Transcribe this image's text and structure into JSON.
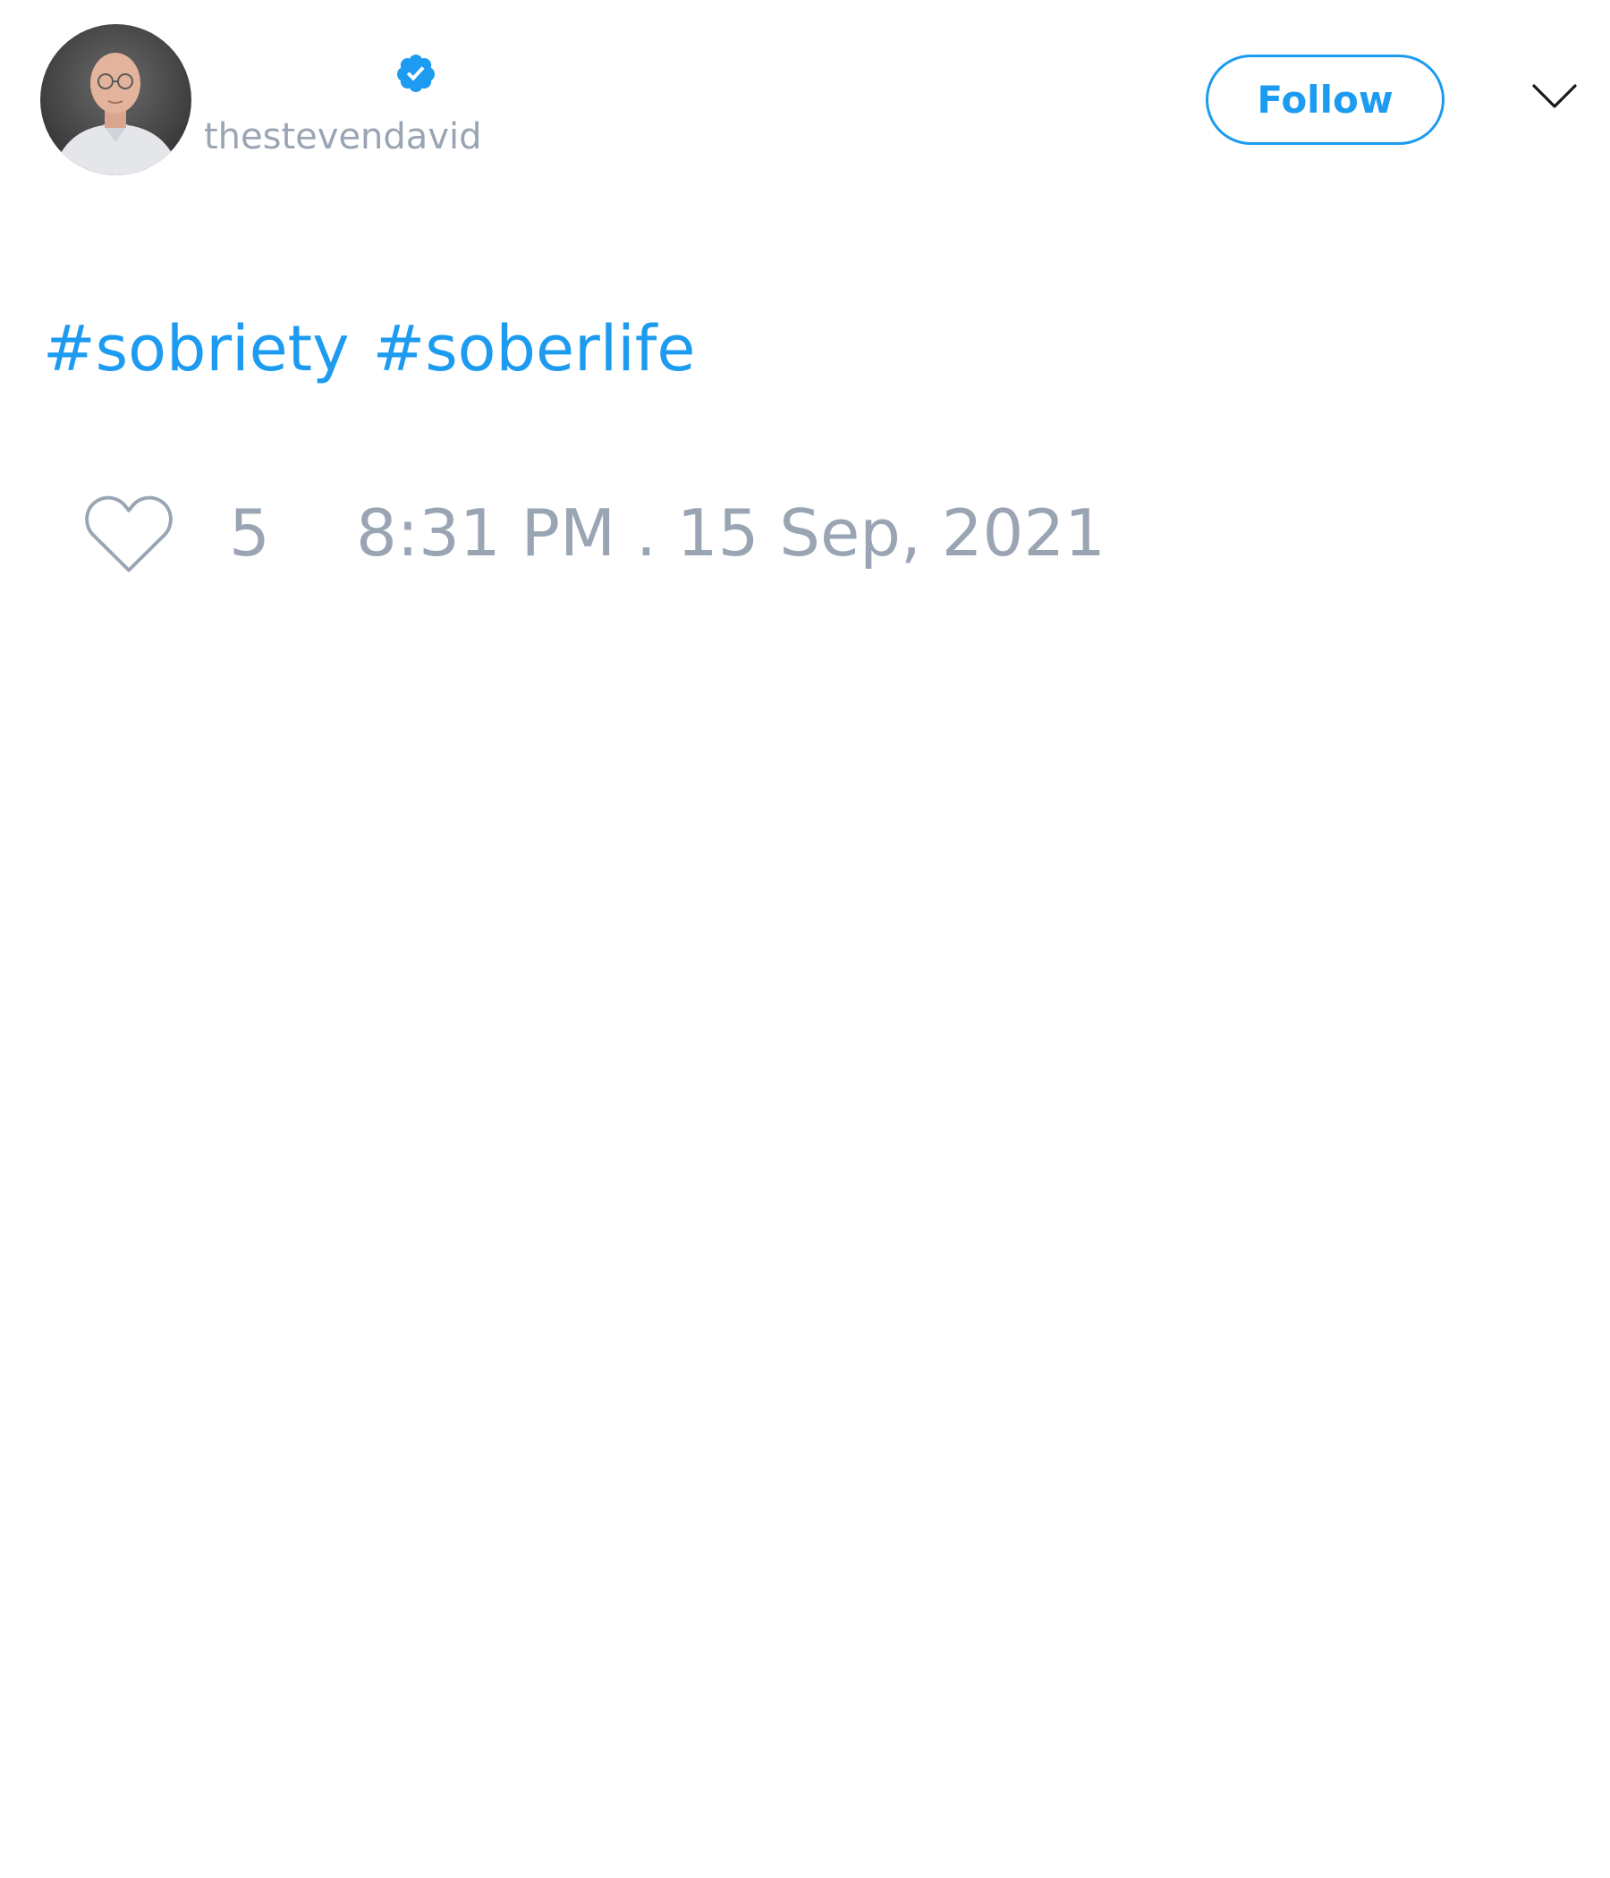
{
  "user": {
    "handle": "thestevendavid",
    "verified": true,
    "avatar_icon": "profile-photo"
  },
  "header": {
    "follow_label": "Follow",
    "menu_icon": "chevron-down-icon"
  },
  "tweet": {
    "hashtags": [
      "#sobriety",
      "#soberlife"
    ]
  },
  "footer": {
    "like_icon": "heart-icon",
    "like_count": "5",
    "timestamp": "8:31 PM . 15 Sep, 2021"
  },
  "colors": {
    "accent": "#1d9bf0",
    "muted_text": "#9aa5b4",
    "background": "#ffffff"
  }
}
